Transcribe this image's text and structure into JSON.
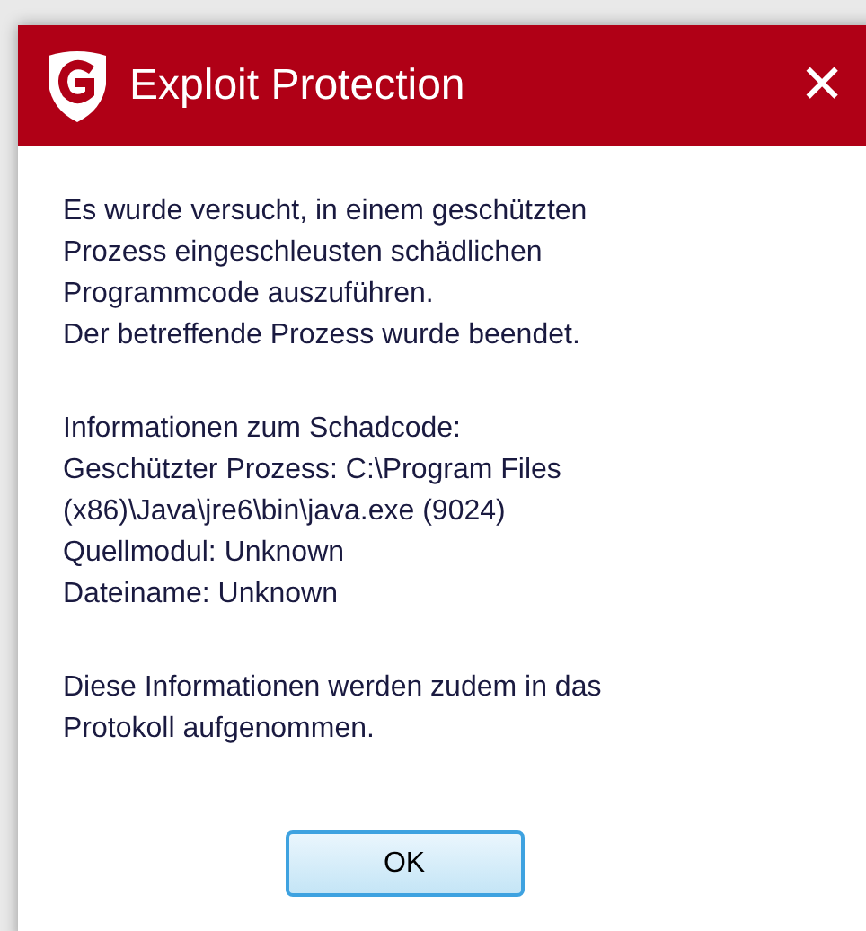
{
  "window": {
    "title": "Exploit Protection",
    "close": "✕"
  },
  "paragraphs": [
    [
      "Es wurde versucht, in einem geschützten",
      "Prozess eingeschleusten schädlichen",
      "Programmcode auszuführen.",
      "Der betreffende Prozess wurde beendet."
    ],
    [
      "Informationen zum Schadcode:",
      "Geschützter Prozess: C:\\Program Files",
      "(x86)\\Java\\jre6\\bin\\java.exe (9024)",
      "Quellmodul: Unknown",
      "Dateiname: Unknown"
    ],
    [
      "Diese Informationen werden zudem in das",
      "Protokoll aufgenommen."
    ]
  ],
  "buttons": [
    {
      "label": "OK"
    }
  ]
}
